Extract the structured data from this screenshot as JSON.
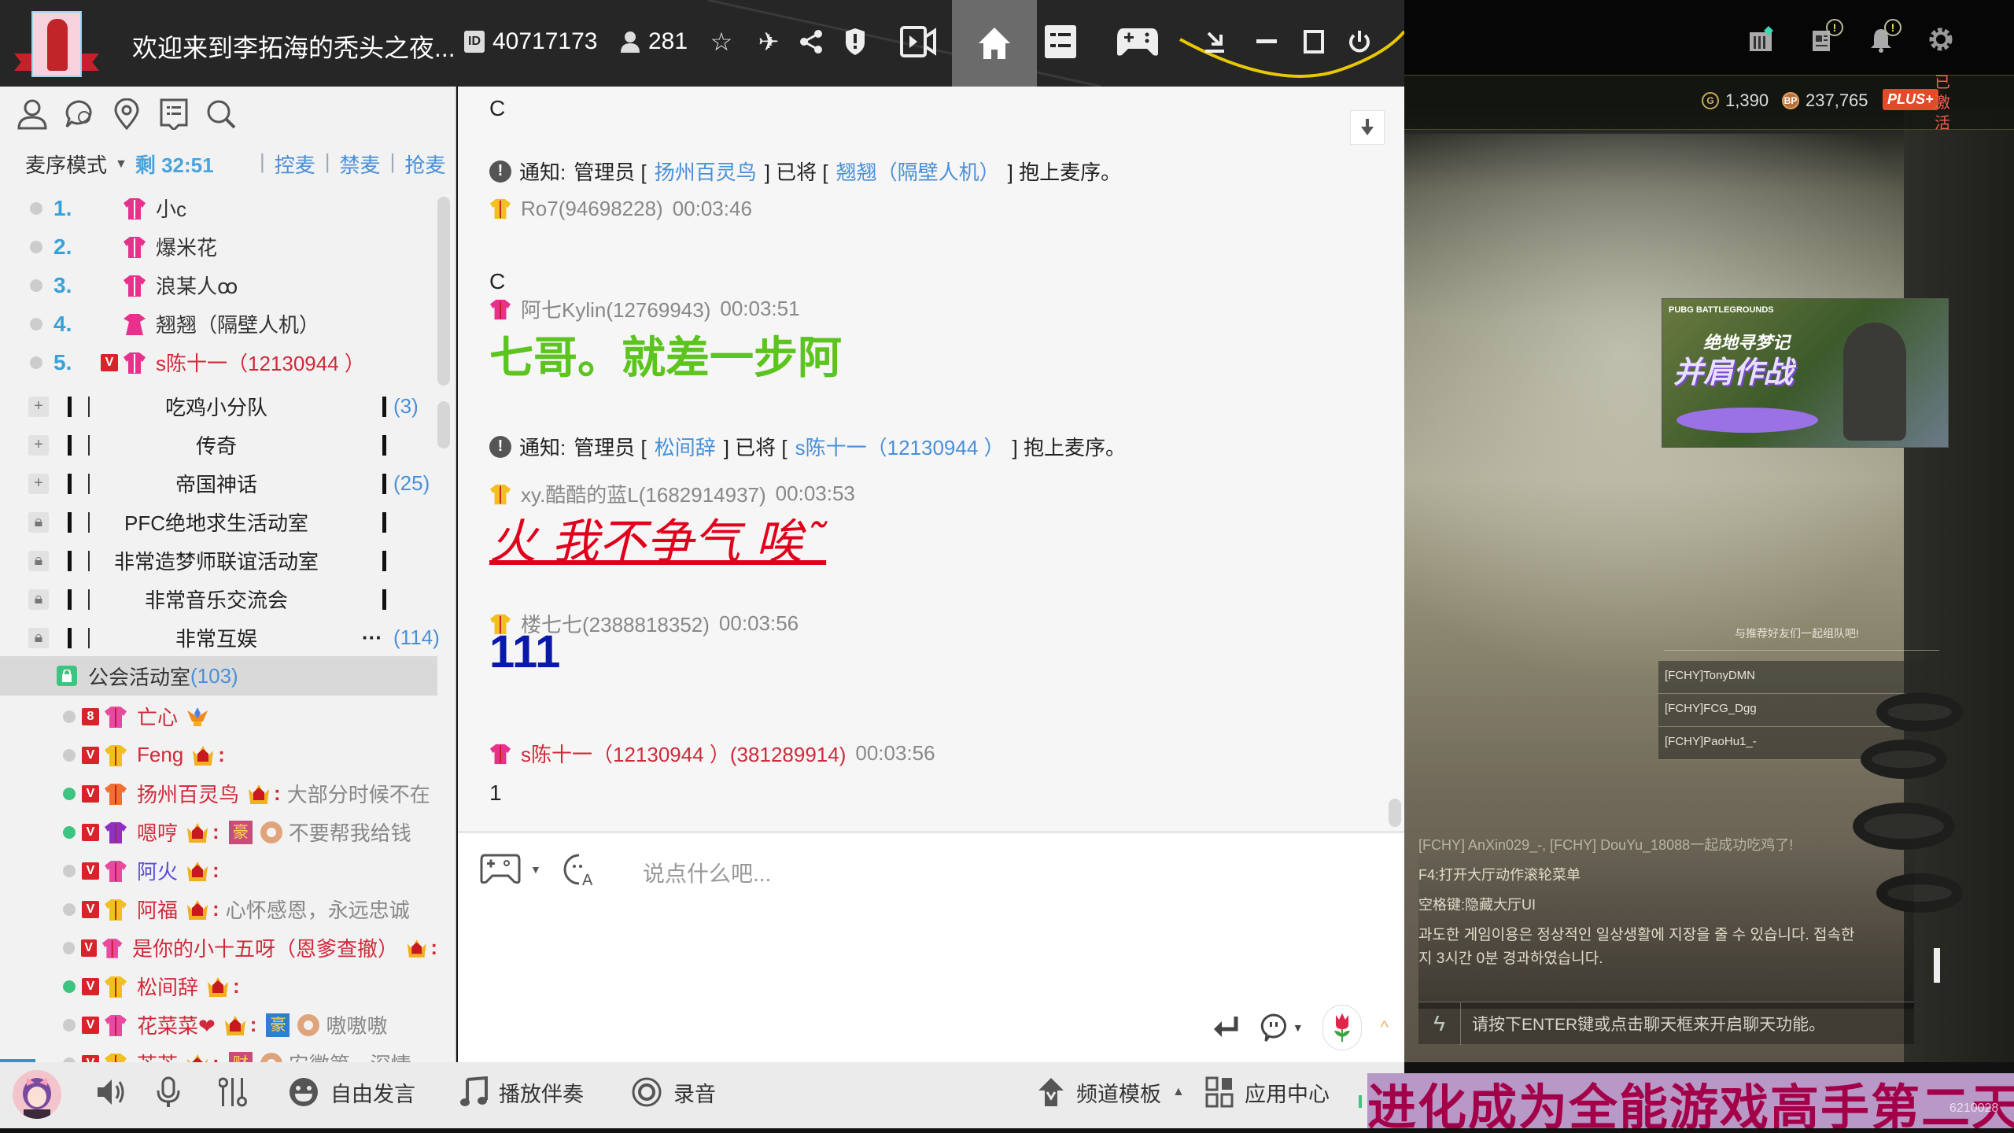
{
  "topbar": {
    "title": "欢迎来到李拓海的秃头之夜...",
    "channel_id": "40717173",
    "online_count": "281",
    "icons": [
      "id-icon",
      "user-icon",
      "star-icon",
      "plane-icon",
      "share-icon",
      "shield-alert-icon",
      "video-icon",
      "home-icon",
      "list-icon",
      "gamepad-icon",
      "download-icon",
      "minimize-icon",
      "maximize-icon",
      "power-icon"
    ],
    "accent": "#e8c800"
  },
  "sidebar": {
    "tools": [
      "user-icon",
      "chat-history-icon",
      "location-icon",
      "notice-icon",
      "search-icon"
    ],
    "mode_label": "麦序模式",
    "remaining": "剩 32:51",
    "actions": [
      "控麦",
      "禁麦",
      "抢麦"
    ],
    "queue": [
      {
        "num": "1.",
        "name": "小c",
        "vip": false,
        "shirt": "pink"
      },
      {
        "num": "2.",
        "name": "爆米花",
        "vip": false,
        "shirt": "pink"
      },
      {
        "num": "3.",
        "name": "浪某人ꝏ",
        "vip": false,
        "shirt": "pink"
      },
      {
        "num": "4.",
        "name": "翘翘（隔壁人机）",
        "vip": false,
        "shirt": "pink-dress"
      },
      {
        "num": "5.",
        "name": "s陈十一（12130944 ）",
        "vip": true,
        "shirt": "pink",
        "red": true
      }
    ],
    "channels": [
      {
        "name": "吃鸡小分队",
        "count": "(3)",
        "icon": "plus"
      },
      {
        "name": "传奇",
        "count": "",
        "icon": "plus"
      },
      {
        "name": "帝国神话",
        "count": "(25)",
        "icon": "plus"
      },
      {
        "name": "PFC绝地求生活动室",
        "count": "",
        "icon": "lock"
      },
      {
        "name": "非常造梦师联谊活动室",
        "count": "",
        "icon": "lock"
      },
      {
        "name": "非常音乐交流会",
        "count": "",
        "icon": "lock"
      },
      {
        "name": "非常互娱",
        "count": "(114)",
        "icon": "lock",
        "more": "···"
      }
    ],
    "active_channel": {
      "name": "公会活动室",
      "count": "(103)"
    },
    "members": [
      {
        "name": "亡心",
        "online": false,
        "badge": "8",
        "name_color": "#d02a3a",
        "shirt": "#e84aa0",
        "message": ""
      },
      {
        "name": "Feng",
        "online": false,
        "badge": "V",
        "name_color": "#d02a3a",
        "shirt": "#f0c020",
        "message": "",
        "crown": true
      },
      {
        "name": "扬州百灵鸟",
        "online": true,
        "badge": "V",
        "name_color": "#d02a3a",
        "shirt": "#f07030",
        "message": "大部分时候不在",
        "crown": true
      },
      {
        "name": "嗯哼",
        "online": true,
        "badge": "V",
        "name_color": "#d02a3a",
        "shirt": "#9030c0",
        "message": "不要帮我给钱",
        "crown": true,
        "hao": "豪",
        "donut": true
      },
      {
        "name": "阿火",
        "online": false,
        "badge": "V",
        "name_color": "#5a4ae0",
        "shirt": "#e84aa0",
        "message": "",
        "crown": true
      },
      {
        "name": "阿福",
        "online": false,
        "badge": "V",
        "name_color": "#d02a3a",
        "shirt": "#f0c020",
        "message": "心怀感恩，永远忠诚",
        "crown": true
      },
      {
        "name": "是你的小十五呀（恩爹查撤）",
        "online": false,
        "badge": "V",
        "name_color": "#d02a3a",
        "shirt": "#e84aa0",
        "message": "",
        "crown": true
      },
      {
        "name": "松间辞",
        "online": true,
        "badge": "V",
        "name_color": "#d02a3a",
        "shirt": "#f0c020",
        "message": "",
        "crown": true
      },
      {
        "name": "花菜菜❤",
        "online": false,
        "badge": "V",
        "name_color": "#d02a3a",
        "shirt": "#e84aa0",
        "message": "嗷嗷嗷",
        "crown": true,
        "hao": "豪",
        "hao_blue": true,
        "donut": true
      },
      {
        "name": "芒芒",
        "online": false,
        "badge": "V",
        "name_color": "#d02a3a",
        "shirt": "#f0c020",
        "message": "安徽第一深情",
        "crown": true,
        "hao": "财",
        "donut": true
      }
    ]
  },
  "chat": {
    "scroll_down_icon": "arrow-down-icon",
    "messages": [
      {
        "type": "plain",
        "text": "C"
      },
      {
        "type": "system",
        "label": "通知:",
        "pre": "管理员 [",
        "admin": "扬州百灵鸟",
        "mid": "] 已将 [",
        "target": "翘翘（隔壁人机）",
        "post": "] 抱上麦序。"
      },
      {
        "type": "head",
        "user": "Ro7(94698228)",
        "time": "00:03:46"
      },
      {
        "type": "plain",
        "text": "C"
      },
      {
        "type": "head",
        "user": "阿七Kylin(12769943)",
        "time": "00:03:51"
      },
      {
        "type": "green",
        "text": "七哥。就差一步阿"
      },
      {
        "type": "system",
        "label": "通知:",
        "pre": "管理员 [",
        "admin": "松间辞",
        "mid": "] 已将 [",
        "target": "s陈十一（12130944 ）",
        "post": "] 抱上麦序。"
      },
      {
        "type": "head",
        "user": "xy.酷酷的蓝L(1682914937)",
        "time": "00:03:53"
      },
      {
        "type": "red",
        "text": "火 我不争气 唉˜"
      },
      {
        "type": "head",
        "user": "楼七七(2388818352)",
        "time": "00:03:56"
      },
      {
        "type": "blue",
        "text": "111"
      },
      {
        "type": "head",
        "user": "s陈十一（12130944 ）(381289914)",
        "time": "00:03:56",
        "red": true
      },
      {
        "type": "plain",
        "text": "1"
      }
    ],
    "input_placeholder": "说点什么吧..."
  },
  "bottombar": {
    "free_speech": "自由发言",
    "play_music": "播放伴奏",
    "record": "录音",
    "channel_template": "频道模板",
    "app_center": "应用中心"
  },
  "game": {
    "g_coin": "1,390",
    "bp": "237,765",
    "plus_label": "PLUS+",
    "activated": "已激活",
    "banner_brand": "PUBG BATTLEGROUNDS",
    "banner_title1": "绝地寻梦记",
    "banner_title2": "并肩作战",
    "invite_title": "与推荐好友们一起组队吧!",
    "friends": [
      "[FCHY]TonyDMN",
      "[FCHY]FCG_Dgg",
      "[FCHY]PaoHu1_-"
    ],
    "chat_lines": [
      "[FCHY] AnXin029_-, [FCHY] DouYu_18088一起成功吃鸡了!",
      "F4:打开大厅动作滚轮菜单",
      "空格键:隐藏大厅UI",
      "과도한 게임이용은 정상적인 일상생활에 지장을 줄 수 있습니다. 접속한",
      "지 3시간 0분 경과하였습니다."
    ],
    "chat_placeholder": "请按下ENTER键或点击聊天框来开启聊天功能。",
    "overlay_banner": "进化成为全能游戏高手第二天",
    "room_watermark": "6210028"
  }
}
